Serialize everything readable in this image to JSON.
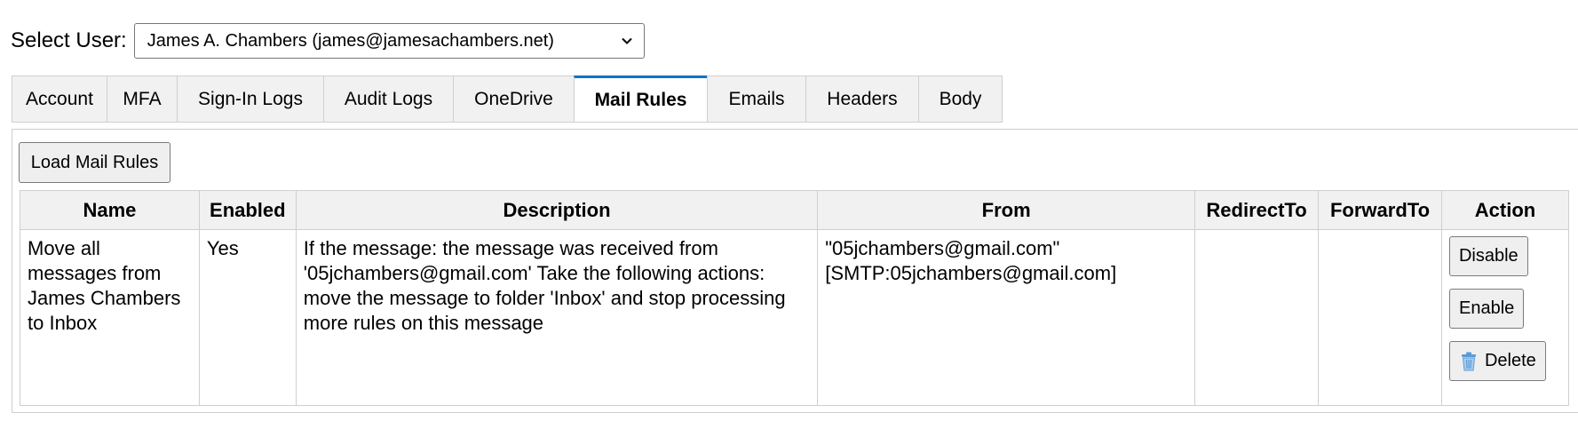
{
  "user_selector": {
    "label": "Select User:",
    "selected": "James A. Chambers (james@jamesachambers.net)"
  },
  "tabs": [
    {
      "label": "Account"
    },
    {
      "label": "MFA"
    },
    {
      "label": "Sign-In Logs"
    },
    {
      "label": "Audit Logs"
    },
    {
      "label": "OneDrive"
    },
    {
      "label": "Mail Rules",
      "active": true
    },
    {
      "label": "Emails"
    },
    {
      "label": "Headers"
    },
    {
      "label": "Body"
    }
  ],
  "mail_rules": {
    "load_button": "Load Mail Rules",
    "columns": [
      "Name",
      "Enabled",
      "Description",
      "From",
      "RedirectTo",
      "ForwardTo",
      "Action"
    ],
    "rows": [
      {
        "name": "Move all messages from James Chambers to Inbox",
        "enabled": "Yes",
        "description": "If the message: the message was received from '05jchambers@gmail.com' Take the following actions: move the message to folder 'Inbox' and stop processing more rules on this message",
        "from": "\"05jchambers@gmail.com\" [SMTP:05jchambers@gmail.com]",
        "redirect_to": "",
        "forward_to": "",
        "actions": {
          "disable": "Disable",
          "enable": "Enable",
          "delete": "Delete"
        }
      }
    ]
  },
  "colors": {
    "active_tab_accent": "#0a74c8",
    "tab_background": "#f1f1f1",
    "border": "#cfcfcf"
  },
  "icons": {
    "select_chevron": "chevron-down-icon",
    "delete": "trash-icon"
  }
}
